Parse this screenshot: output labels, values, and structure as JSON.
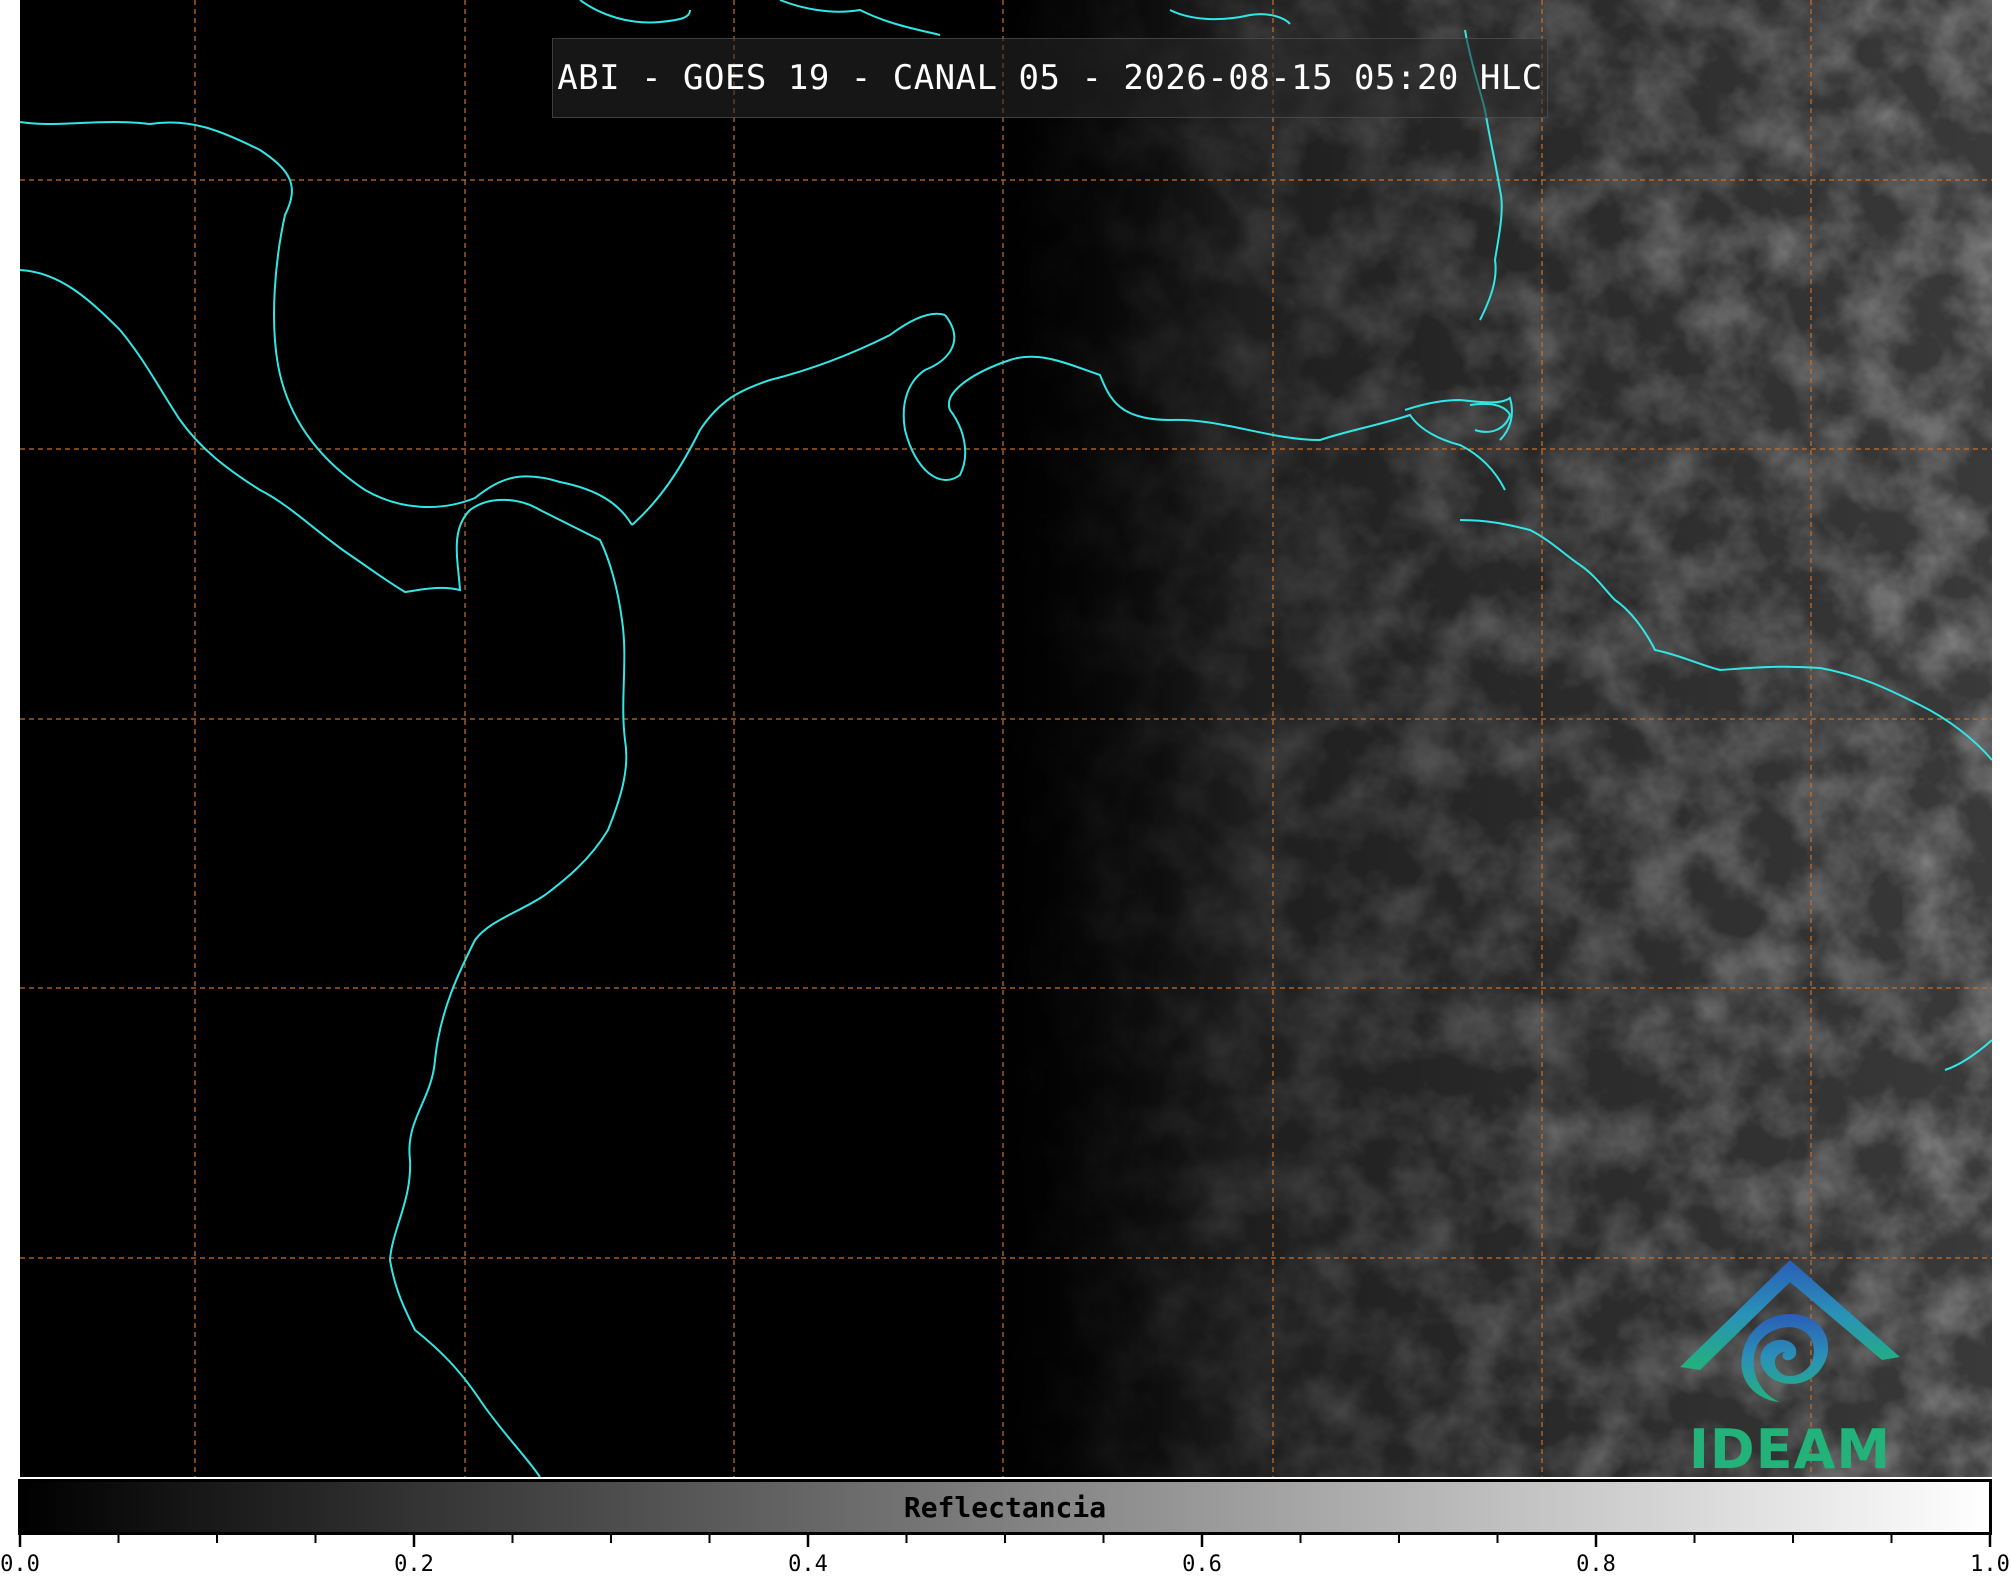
{
  "map": {
    "title": "ABI - GOES 19 - CANAL 05 - 2026-08-15 05:20 HLC",
    "coastline_color": "#33e6e6",
    "grid_color": "#c8702a",
    "background_color": "#000000"
  },
  "logo": {
    "text": "IDEAM",
    "color": "#22b27a"
  },
  "colorbar": {
    "label": "Reflectancia",
    "range": [
      0.0,
      1.0
    ],
    "major_ticks": [
      "0.0",
      "0.2",
      "0.4",
      "0.6",
      "0.8",
      "1.0"
    ],
    "minor_step": 0.05,
    "gradient_start": "#000000",
    "gradient_end": "#ffffff"
  }
}
